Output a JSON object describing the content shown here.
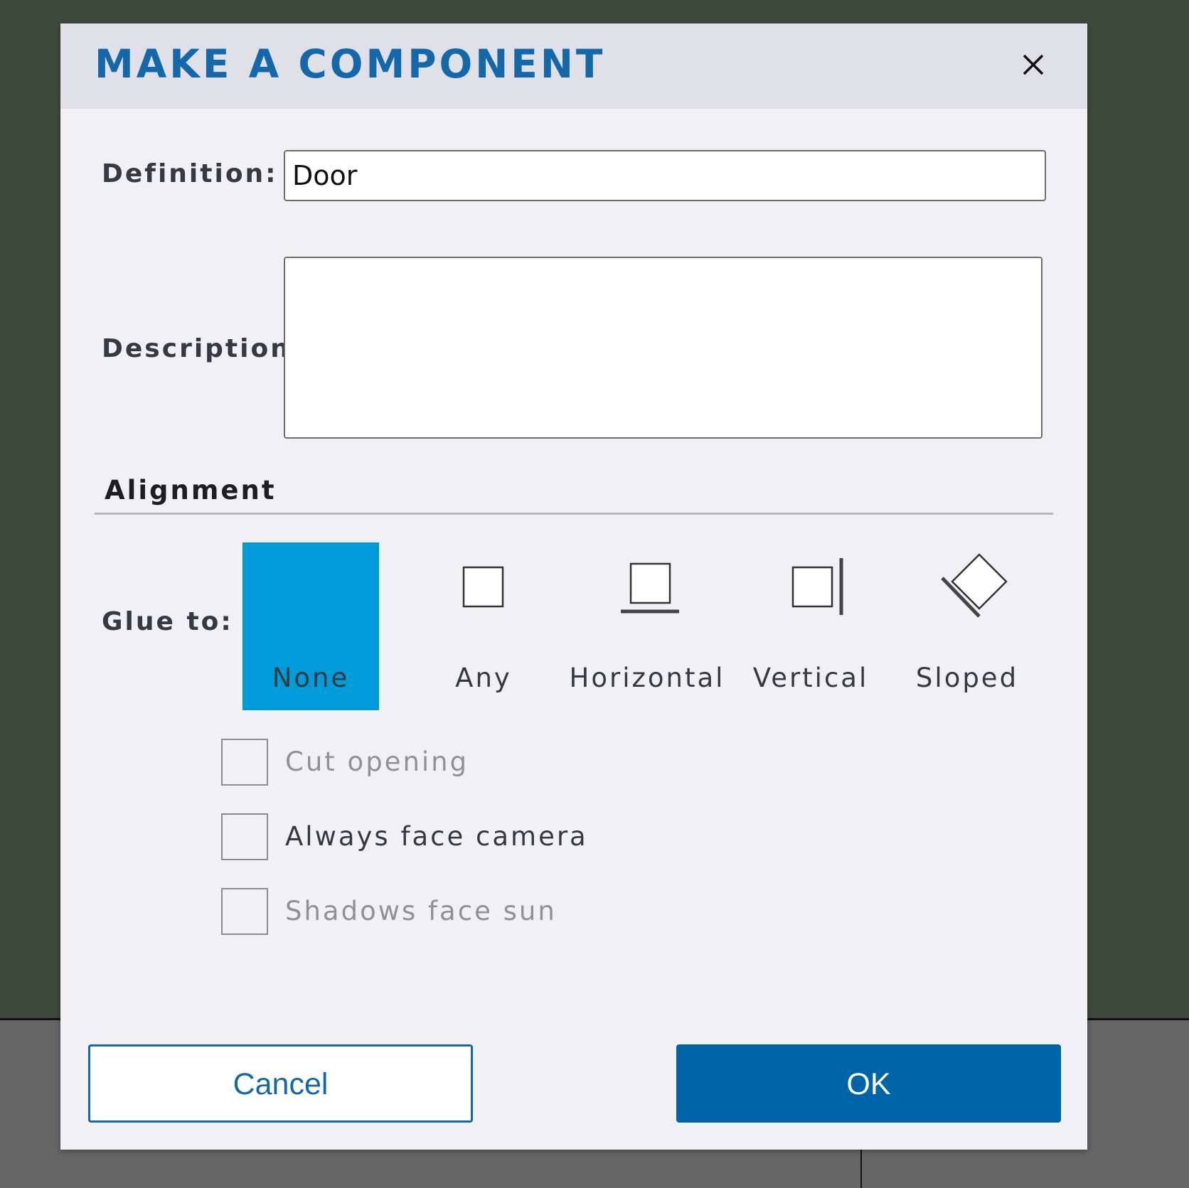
{
  "dialog": {
    "title": "MAKE A COMPONENT",
    "close_icon": "close-icon"
  },
  "definition": {
    "label": "Definition:",
    "value": "Door"
  },
  "description": {
    "label": "Description:",
    "value": ""
  },
  "alignment": {
    "title": "Alignment",
    "glue_label": "Glue to:",
    "selected": "None",
    "options": [
      {
        "label": "None",
        "icon": "none",
        "selected": true
      },
      {
        "label": "Any",
        "icon": "any-square-icon",
        "selected": false
      },
      {
        "label": "Horizontal",
        "icon": "horizontal-plane-icon",
        "selected": false
      },
      {
        "label": "Vertical",
        "icon": "vertical-plane-icon",
        "selected": false
      },
      {
        "label": "Sloped",
        "icon": "sloped-plane-icon",
        "selected": false
      }
    ]
  },
  "options": {
    "cut_opening": {
      "label": "Cut opening",
      "checked": false,
      "enabled": false
    },
    "always_face_camera": {
      "label": "Always face camera",
      "checked": false,
      "enabled": true
    },
    "shadows_face_sun": {
      "label": "Shadows face sun",
      "checked": false,
      "enabled": false
    }
  },
  "buttons": {
    "cancel": "Cancel",
    "ok": "OK"
  },
  "colors": {
    "accent": "#1467a8",
    "selected_option": "#009cd9",
    "ok_button": "#0065a8",
    "background": "#3d4a3b"
  }
}
